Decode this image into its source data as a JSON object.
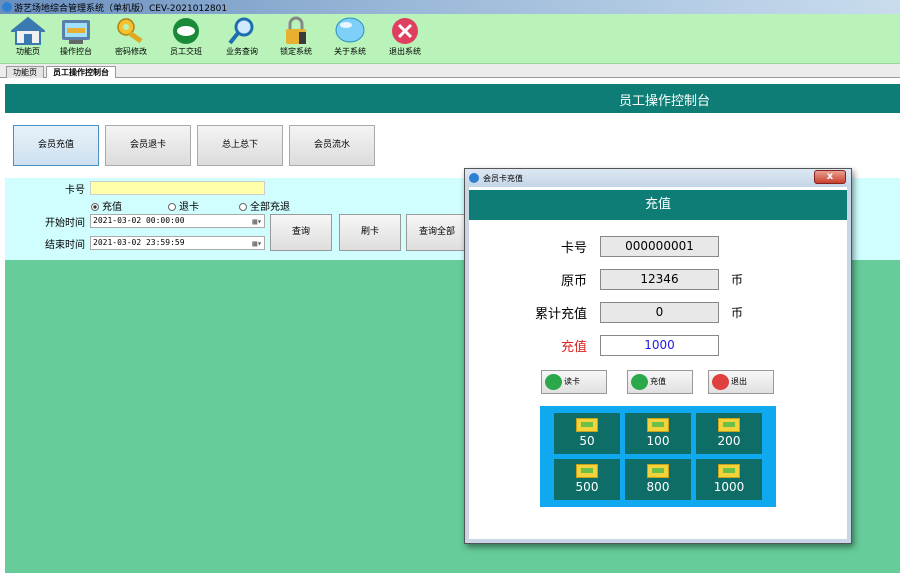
{
  "window": {
    "title": "游艺场地综合管理系统（单机版）CEV-2021012801"
  },
  "toolbar": {
    "items": [
      {
        "label": "功能页",
        "icon": "home-icon"
      },
      {
        "label": "操作控台",
        "icon": "console-icon"
      },
      {
        "label": "密码修改",
        "icon": "key-icon"
      },
      {
        "label": "员工交班",
        "icon": "handshake-icon"
      },
      {
        "label": "业务查询",
        "icon": "magnifier-icon"
      },
      {
        "label": "锁定系统",
        "icon": "lock-icon"
      },
      {
        "label": "关于系统",
        "icon": "info-bubble-icon"
      },
      {
        "label": "退出系统",
        "icon": "exit-icon"
      }
    ]
  },
  "tabs": [
    {
      "label": "功能页"
    },
    {
      "label": "员工操作控制台"
    }
  ],
  "main": {
    "title": "员工操作控制台",
    "buttons": [
      "会员充值",
      "会员退卡",
      "总上总下",
      "会员流水"
    ]
  },
  "filter": {
    "card_label": "卡号",
    "card_value": "",
    "radios": [
      {
        "label": "充值",
        "checked": true
      },
      {
        "label": "退卡",
        "checked": false
      },
      {
        "label": "全部充退",
        "checked": false
      }
    ],
    "start_label": "开始时间",
    "start_value": "2021-03-02 00:00:00",
    "end_label": "结束时间",
    "end_value": "2021-03-02 23:59:59",
    "buttons": [
      "查询",
      "刷卡",
      "查询全部"
    ]
  },
  "dialog": {
    "title": "会员卡充值",
    "header": "充值",
    "close": "x",
    "fields": [
      {
        "label": "卡号",
        "value": "000000001",
        "unit": ""
      },
      {
        "label": "原币",
        "value": "12346",
        "unit": "币"
      },
      {
        "label": "累计充值",
        "value": "0",
        "unit": "币"
      },
      {
        "label": "充值",
        "value": "1000",
        "unit": ""
      }
    ],
    "actions": [
      {
        "label": "读卡",
        "icon": "chat-icon",
        "color": "#2aa84a"
      },
      {
        "label": "充值",
        "icon": "checkmark-icon",
        "color": "#2aa84a"
      },
      {
        "label": "退出",
        "icon": "close-icon",
        "color": "#e04040"
      }
    ],
    "quick_amounts": [
      "50",
      "100",
      "200",
      "500",
      "800",
      "1000"
    ]
  },
  "colors": {
    "teal": "#0e7d76",
    "green_bg": "#66cc99",
    "toolbar_bg": "#b9f3b9",
    "filter_bg": "#d0fefe",
    "quick_bg": "#10a8ee"
  }
}
